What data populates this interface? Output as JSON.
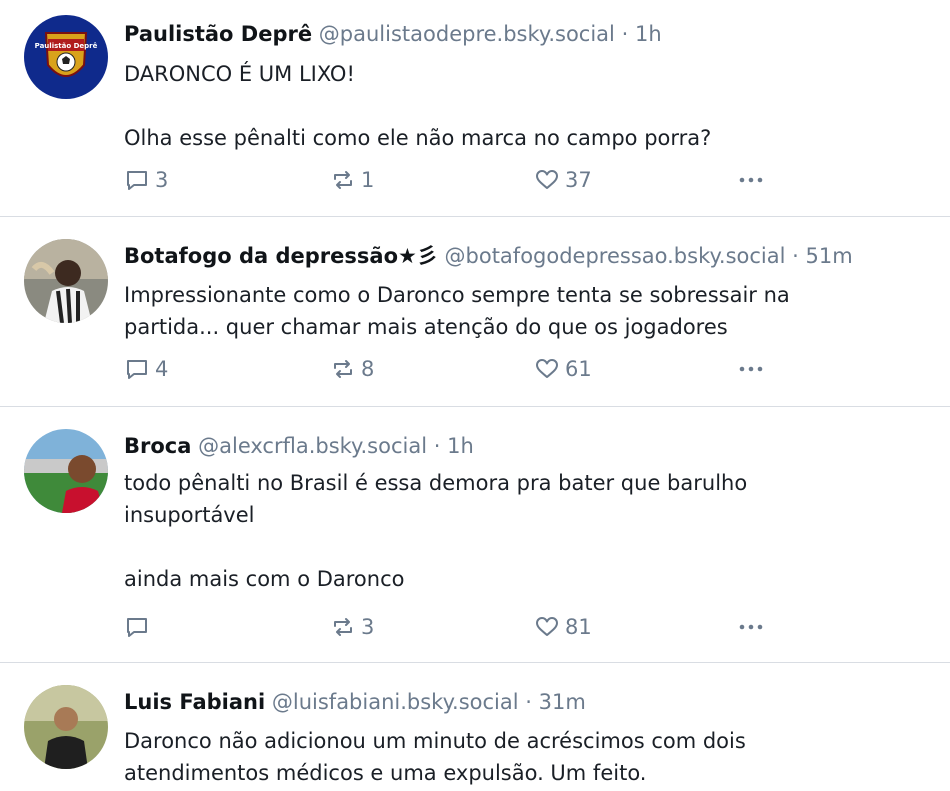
{
  "posts": [
    {
      "name": "Paulistão Deprê",
      "handle": "@paulistaodepre.bsky.social",
      "separator": "·",
      "time": "1h",
      "avatar_text": "Paulistão Deprê",
      "paragraphs": [
        "DARONCO É UM LIXO!",
        "",
        "Olha esse pênalti como ele não marca no campo porra?"
      ],
      "replies": "3",
      "reposts": "1",
      "likes": "37"
    },
    {
      "name": "Botafogo da depressão★彡",
      "handle": "@botafogodepressao.bsky.social",
      "separator": "·",
      "time": "51m",
      "paragraphs": [
        "Impressionante como o Daronco sempre tenta se sobressair na partida... quer chamar mais atenção do que os jogadores"
      ],
      "replies": "4",
      "reposts": "8",
      "likes": "61"
    },
    {
      "name": "Broca",
      "handle": "@alexcrfla.bsky.social",
      "separator": "·",
      "time": "1h",
      "paragraphs": [
        "todo pênalti no Brasil é essa demora pra bater que barulho insuportável",
        "",
        "ainda mais com o Daronco"
      ],
      "replies": "",
      "reposts": "3",
      "likes": "81"
    },
    {
      "name": "Luis Fabiani",
      "handle": "@luisfabiani.bsky.social",
      "separator": "·",
      "time": "31m",
      "paragraphs": [
        "Daronco não adicionou um minuto de acréscimos com dois atendimentos médicos e uma expulsão. Um feito."
      ]
    }
  ],
  "icons": {
    "reply": "speech-bubble-icon",
    "repost": "repost-arrows-icon",
    "like": "heart-icon",
    "more": "ellipsis-icon"
  },
  "colors": {
    "meta": "#6b7a8c",
    "text": "#1a1f26",
    "divider": "#d9dde3"
  }
}
